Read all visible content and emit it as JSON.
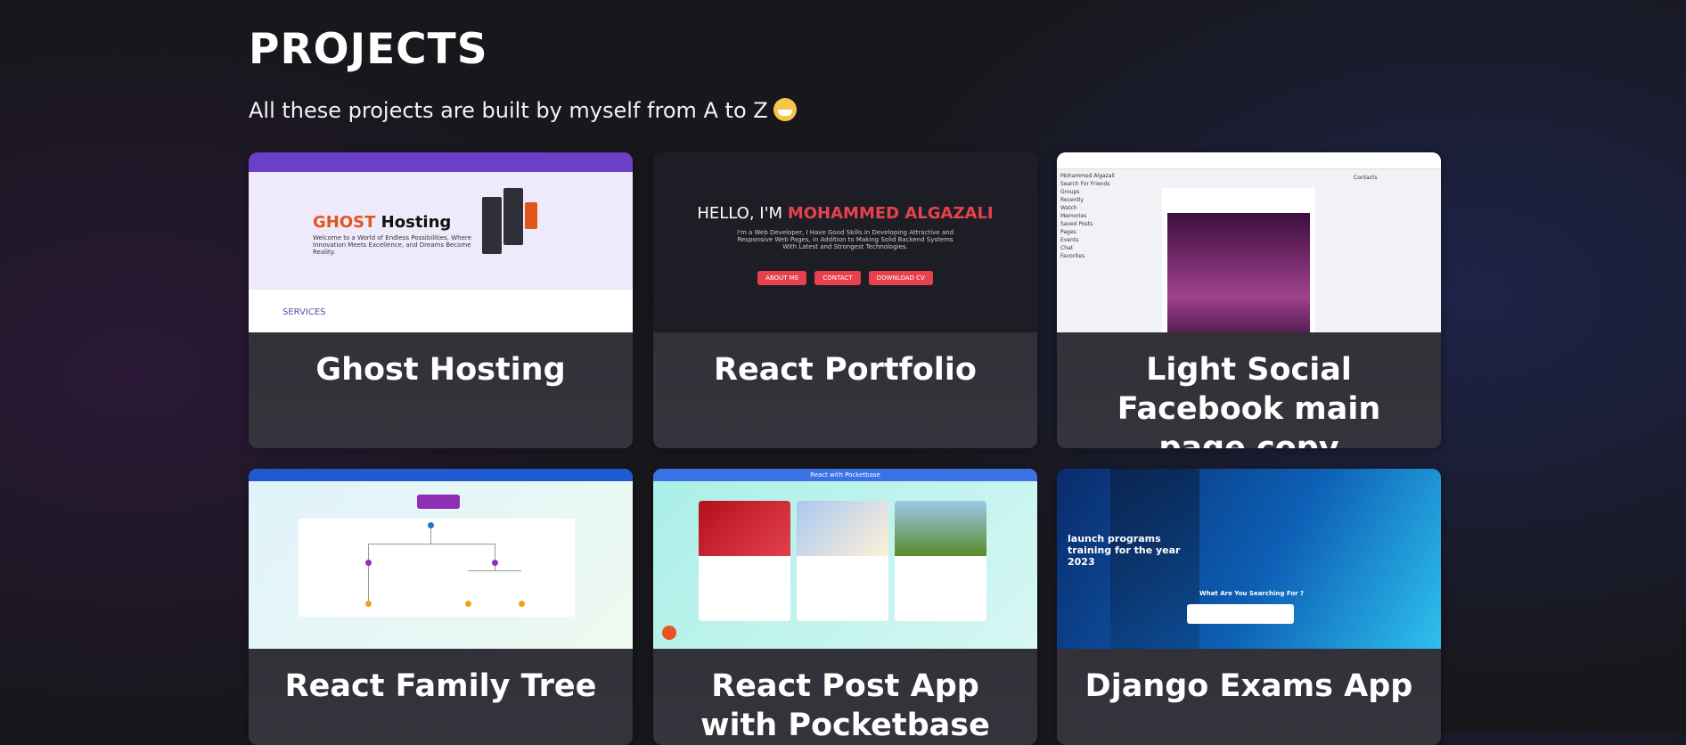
{
  "header": {
    "title": "PROJECTS",
    "subtitle": "All these projects are built by myself from A to Z"
  },
  "projects": [
    {
      "title": "Ghost Hosting"
    },
    {
      "title": "React Portfolio"
    },
    {
      "title": "Light Social Facebook main page copy"
    },
    {
      "title": "React Family Tree"
    },
    {
      "title": "React Post App with Pocketbase"
    },
    {
      "title": "Django Exams App"
    }
  ],
  "screenshots": {
    "ghost": {
      "headline_accent": "GHOST",
      "headline": "Hosting",
      "text": "Welcome to a World of Endless Possibilities, Where Innovation Meets Excellence, and Dreams Become Reality.",
      "section": "SERVICES"
    },
    "portfolio": {
      "greeting": "HELLO, I'M",
      "name": "MOHAMMED ALGAZALI",
      "text": "I'm a Web Developer, I Have Good Skills in Developing Attractive and Responsive Web Pages, in Addition to Making Solid Backend Systems With Latest and Strongest Technologies.",
      "btn_about": "ABOUT ME",
      "btn_contact": "CONTACT",
      "btn_cv": "DOWNLOAD CV"
    },
    "facebook": {
      "menu": [
        "Mohammed Algazali",
        "Search For Friends",
        "Groups",
        "Recently",
        "Watch",
        "Memories",
        "Saved Posts",
        "Pages",
        "Events",
        "Chat",
        "Favorites"
      ],
      "contacts_label": "Contacts"
    },
    "pocketbase": {
      "title": "React with Pocketbase"
    },
    "django": {
      "headline": "launch programs training for the year 2023",
      "search_title": "What Are You Searching For ?"
    }
  }
}
